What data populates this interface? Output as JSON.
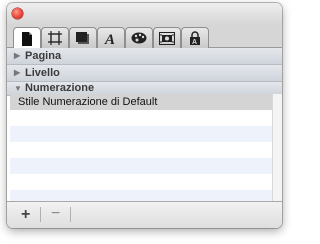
{
  "window": {
    "close_icon": "close-button-red"
  },
  "tabs": [
    {
      "icon": "document-icon",
      "active": true
    },
    {
      "icon": "crop-frame-icon",
      "active": false
    },
    {
      "icon": "shadow-square-icon",
      "active": false
    },
    {
      "icon": "font-letter-a-icon",
      "active": false
    },
    {
      "icon": "color-palette-icon",
      "active": false
    },
    {
      "icon": "image-frame-icon",
      "active": false
    },
    {
      "icon": "lock-icon",
      "active": false
    }
  ],
  "sections": {
    "pagina": {
      "label": "Pagina",
      "expanded": false
    },
    "livello": {
      "label": "Livello",
      "expanded": false
    },
    "numerazione": {
      "label": "Numerazione",
      "expanded": true
    }
  },
  "numbering_list": {
    "items": [
      "Stile Numerazione di Default"
    ]
  },
  "bottom_bar": {
    "add_label": "+",
    "remove_label": "−"
  },
  "colors": {
    "close_button": "#e8463a",
    "selected_row": "#d4d4d4",
    "alternate_row": "#eef3fb"
  }
}
